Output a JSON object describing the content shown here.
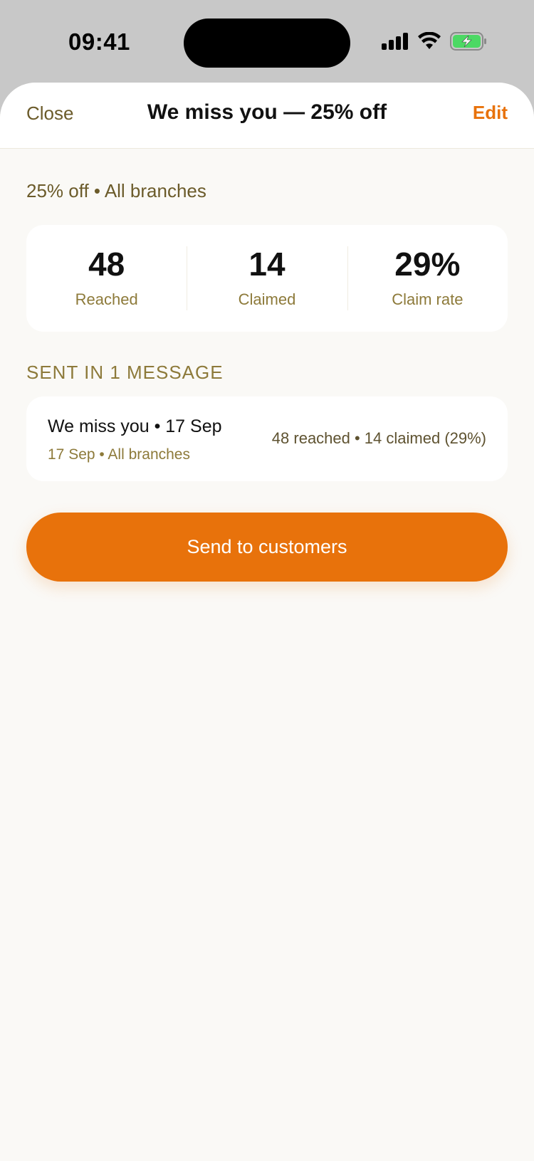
{
  "status_bar": {
    "time": "09:41",
    "icons": [
      "cellular-signal-icon",
      "wifi-icon",
      "battery-charging-icon"
    ],
    "battery_color": "#4cd964"
  },
  "header": {
    "close_label": "Close",
    "title": "We miss you — 25% off",
    "edit_label": "Edit"
  },
  "summary": {
    "subtitle": "25% off • All branches"
  },
  "stats": [
    {
      "value": "48",
      "label": "Reached"
    },
    {
      "value": "14",
      "label": "Claimed"
    },
    {
      "value": "29%",
      "label": "Claim rate"
    }
  ],
  "messages_section": {
    "label": "SENT IN 1 MESSAGE",
    "items": [
      {
        "title": "We miss you • 17 Sep",
        "subtitle": "17 Sep • All branches",
        "stats": "48 reached • 14 claimed (29%)"
      }
    ]
  },
  "actions": {
    "send_label": "Send to customers"
  },
  "colors": {
    "accent": "#e8720b",
    "muted_gold": "#8d7a3a",
    "background": "#faf9f6"
  }
}
